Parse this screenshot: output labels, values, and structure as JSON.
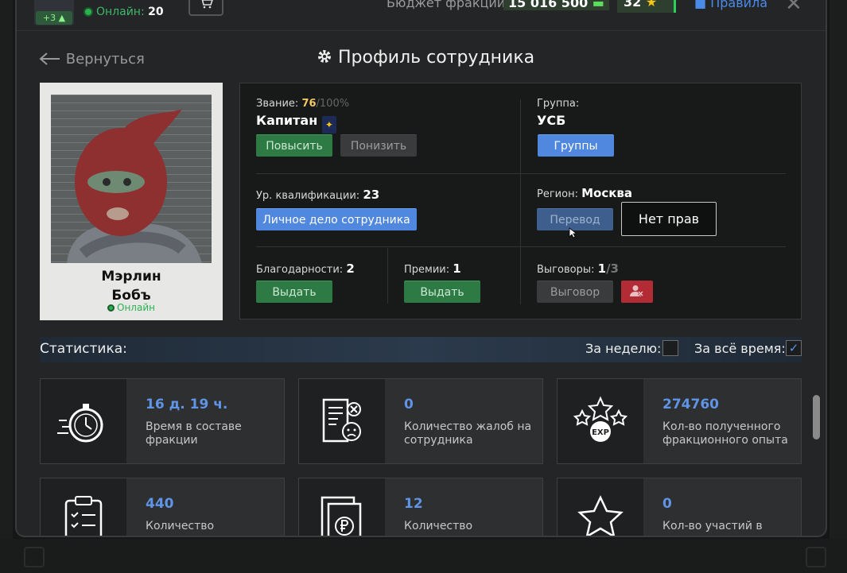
{
  "topbar": {
    "rank_plus": "+3",
    "online_label": "Онлайн:",
    "online_count": "20",
    "cart_icon": "cart-icon",
    "budget_label": "Бюджет фракции:",
    "budget_value": "15 016 500",
    "stars_value": "32",
    "rules_label": "Правила"
  },
  "header": {
    "back_label": "Вернуться",
    "title": "Профиль сотрудника"
  },
  "employee": {
    "name_first": "Мэрлин",
    "name_last": "Бобъ",
    "status": "Онлайн"
  },
  "profile": {
    "rank_label": "Звание:",
    "rank_progress": "76",
    "rank_progress_max": "/100%",
    "rank_name": "Капитан",
    "promote_label": "Повысить",
    "demote_label": "Понизить",
    "group_label": "Группа:",
    "group_value": "УСБ",
    "groups_button": "Группы",
    "qualification_label": "Ур. квалификации:",
    "qualification_value": "23",
    "personal_file_button": "Личное дело сотрудника",
    "region_label": "Регион:",
    "region_value": "Москва",
    "transfer_button": "Перевод",
    "no_rights_tooltip": "Нет прав",
    "thanks_label": "Благодарности:",
    "thanks_value": "2",
    "thanks_button": "Выдать",
    "bonus_label": "Премии:",
    "bonus_value": "1",
    "bonus_button": "Выдать",
    "reprimand_label": "Выговоры:",
    "reprimand_value": "1",
    "reprimand_max": "/3",
    "reprimand_button": "Выговор"
  },
  "stats": {
    "title": "Статистика:",
    "week_label": "За неделю:",
    "week_checked": false,
    "alltime_label": "За всё время:",
    "alltime_checked": true,
    "cards": [
      {
        "value": "16 д. 19 ч.",
        "label": "Время в составе фракции",
        "icon": "stopwatch-icon"
      },
      {
        "value": "0",
        "label": "Количество жалоб на сотрудника",
        "icon": "complaint-icon"
      },
      {
        "value": "274760",
        "label": "Кол-во полученного фракционного опыта",
        "icon": "exp-icon"
      },
      {
        "value": "440",
        "label": "Количество",
        "icon": "clipboard-icon"
      },
      {
        "value": "12",
        "label": "Количество",
        "icon": "ruble-document-icon"
      },
      {
        "value": "0",
        "label": "Кол-во участий в",
        "icon": "star-icon"
      }
    ]
  },
  "colors": {
    "accent_blue": "#5f94e6",
    "green": "#2e7a45",
    "red": "#b32b34",
    "online": "#2bb14f"
  }
}
